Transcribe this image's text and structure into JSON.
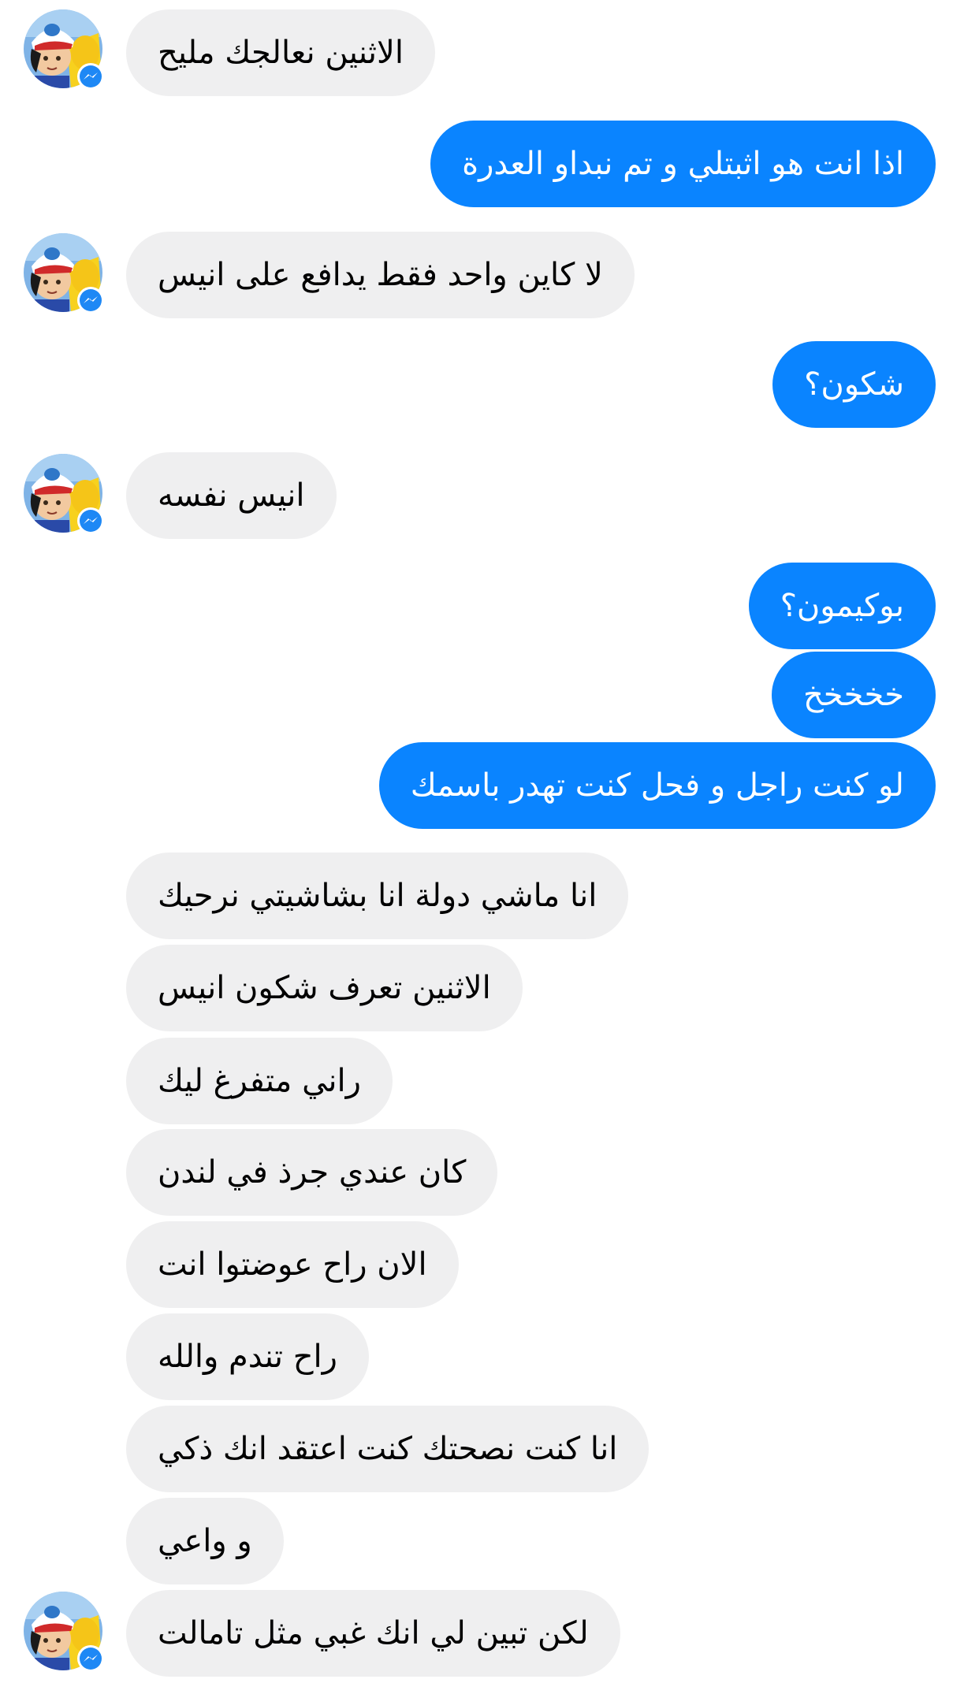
{
  "conversation": {
    "messages": [
      {
        "from": "them",
        "text": "الاثنين نعالجك مليح"
      },
      {
        "from": "me",
        "text": "اذا انت هو اثبتلي و تم نبداو العدرة"
      },
      {
        "from": "them",
        "text": "لا كاين واحد فقط يدافع على انيس"
      },
      {
        "from": "me",
        "text": "شكون؟"
      },
      {
        "from": "them",
        "text": "انيس نفسه"
      },
      {
        "from": "me",
        "text": "بوكيمون؟"
      },
      {
        "from": "me",
        "text": "خخخخخ"
      },
      {
        "from": "me",
        "text": "لو كنت راجل و فحل كنت تهدر باسمك"
      },
      {
        "from": "them",
        "text": "انا ماشي دولة انا بشاشيتي نرحيك"
      },
      {
        "from": "them",
        "text": "الاثنين تعرف شكون انيس"
      },
      {
        "from": "them",
        "text": "راني متفرغ ليك"
      },
      {
        "from": "them",
        "text": "كان عندي جرذ في لندن"
      },
      {
        "from": "them",
        "text": "الان راح عوضتوا انت"
      },
      {
        "from": "them",
        "text": "راح تندم والله"
      },
      {
        "from": "them",
        "text": "انا كنت نصحتك كنت اعتقد انك ذكي"
      },
      {
        "from": "them",
        "text": "و واعي"
      },
      {
        "from": "them",
        "text": "لكن تبين لي انك غبي مثل تامالت"
      }
    ]
  },
  "colors": {
    "incoming_bubble": "#efeff0",
    "outgoing_bubble": "#0a84ff",
    "messenger_badge": "#1e88f5"
  },
  "icons": {
    "avatar": "contact-avatar-cartoon",
    "badge": "messenger-bolt-icon"
  }
}
